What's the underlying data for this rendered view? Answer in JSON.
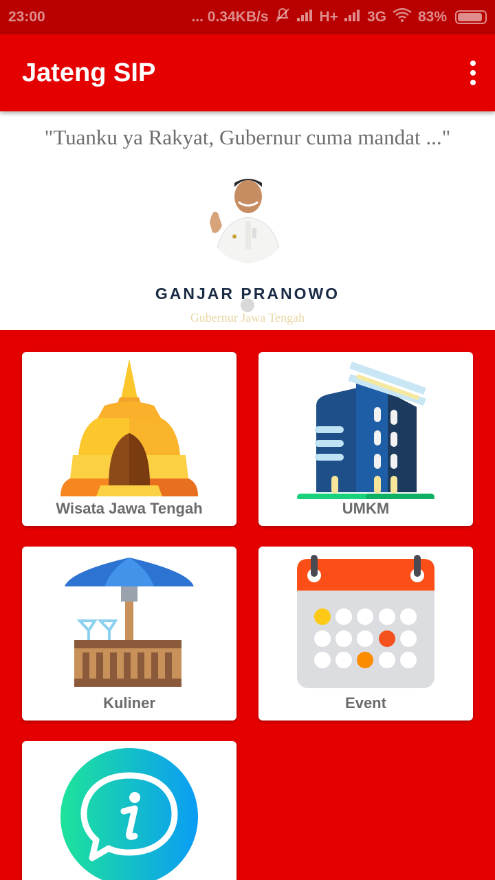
{
  "status_bar": {
    "time": "23:00",
    "network_speed": "... 0.34KB/s",
    "network_type_1": "H+",
    "network_type_2": "3G",
    "battery": "83%"
  },
  "app_bar": {
    "title": "Jateng SIP"
  },
  "banner": {
    "quote": "\"Tuanku ya Rakyat, Gubernur cuma mandat ...\"",
    "name": "GANJAR PRANOWO",
    "title": "Gubernur Jawa Tengah"
  },
  "menu": [
    {
      "label": "Wisata Jawa Tengah",
      "icon": "temple-icon"
    },
    {
      "label": "UMKM",
      "icon": "building-icon"
    },
    {
      "label": "Kuliner",
      "icon": "cafe-icon"
    },
    {
      "label": "Event",
      "icon": "calendar-icon"
    },
    {
      "label": "",
      "icon": "info-chat-icon"
    }
  ],
  "colors": {
    "primary": "#e50000",
    "status_bar": "#b80000",
    "card_label": "#6b6b6b"
  }
}
